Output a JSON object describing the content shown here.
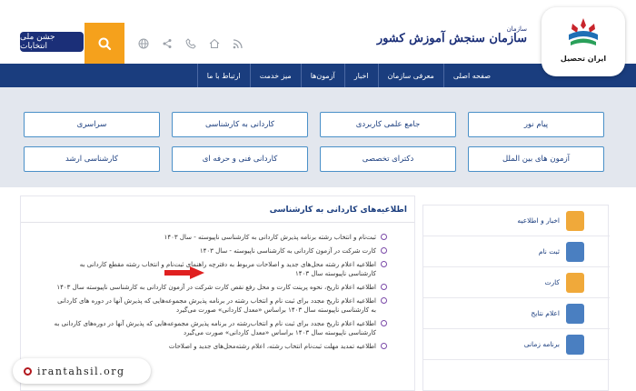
{
  "header": {
    "slogan": "جشن ملی انتخابات",
    "site_logo": "سازمان سنجش آموزش کشور",
    "site_logo_sub": "سازمان",
    "icons": [
      "rss-icon",
      "home-icon",
      "phone-icon",
      "share-icon",
      "globe-icon"
    ]
  },
  "nav": {
    "items": [
      "صفحه اصلی",
      "معرفی سازمان",
      "اخبار",
      "آزمون‌ها",
      "میز خدمت",
      "ارتباط با ما"
    ]
  },
  "tiles": {
    "row1": [
      "پیام نور",
      "جامع علمی کاربردی",
      "کاردانی به کارشناسی",
      "سراسری"
    ],
    "row2": [
      "آزمون های بین الملل",
      "دکترای تخصصی",
      "کاردانی فنی و حرفه ای",
      "کارشناسی ارشد"
    ]
  },
  "panel": {
    "title": "اطلاعیه‌های کاردانی به کارشناسی",
    "news": [
      "ثبت‌نام و انتخاب رشته برنامه پذیرش کاردانی به کارشناسی ناپیوسته - سال ۱۴۰۳",
      "کارت شرکت در آزمون کاردانی به کارشناسی ناپیوسته - سال ۱۴۰۳",
      "اطلاعیه اعلام رشته محل‌های جدید و اصلاحات مربوط به دفترچه راهنمای ثبت‌نام و انتخاب رشته مقطع کاردانی به کارشناسی ناپیوسته سال ۱۴۰۳",
      "اطلاعیه اعلام تاریخ، نحوه پرینت کارت و محل رفع نقص کارت شرکت در آزمون کاردانی به کارشناسی ناپیوسته سال ۱۴۰۳",
      "اطلاعیه اعلام تاریخ مجدد برای ثبت نام و انتخاب رشته در برنامه پذیرش مجموعه‌هایی که پذیرش آنها در دوره های کاردانی به کارشناسی ناپیوسته سال ۱۴۰۳ براساس «معدل کاردانی» صورت می‌گیرد",
      "اطلاعیه اعلام تاریخ مجدد برای ثبت نام و انتخاب‌رشته در برنامه پذیرش مجموعه‌هایی که پذیرش آنها در دوره‌های کاردانی به کارشناسی ناپیوسته سال ۱۴۰۳ براساس «معدل کاردانی» صورت می‌گیرد",
      "اطلاعیه تمدید مهلت ثبت‌نام انتخاب رشته، اعلام رشته‌محل‌های جدید و اصلاحات"
    ]
  },
  "sidebar": {
    "items": [
      {
        "label": "اخبار و اطلاعیه",
        "icon": "news-icon",
        "color": "#f0a93a"
      },
      {
        "label": "ثبت نام",
        "icon": "register-icon",
        "color": "#4a7fc1"
      },
      {
        "label": "کارت",
        "icon": "card-icon",
        "color": "#f0a93a"
      },
      {
        "label": "اعلام نتایج",
        "icon": "results-icon",
        "color": "#4a7fc1"
      },
      {
        "label": "برنامه زمانی",
        "icon": "calendar-icon",
        "color": "#4a7fc1"
      }
    ]
  },
  "badge": {
    "text": "ایران تحصیل"
  },
  "footer": {
    "url": "irantahsil.org"
  },
  "colors": {
    "nav": "#1a3d7e",
    "accent": "#f5a11c",
    "tile_border": "#4a90c8",
    "arrow": "#e02020"
  }
}
